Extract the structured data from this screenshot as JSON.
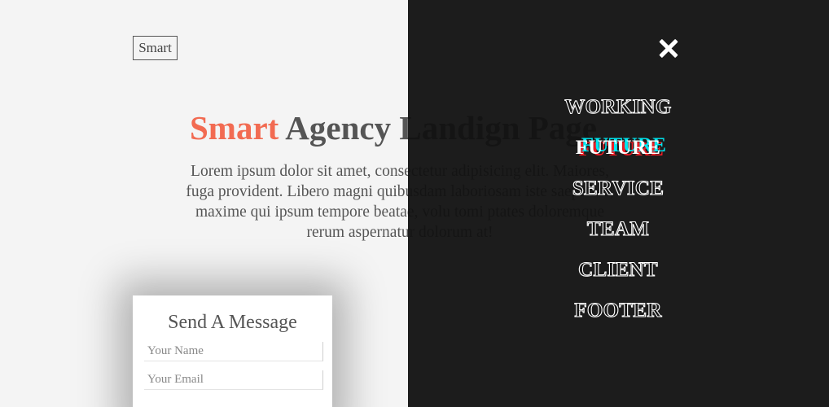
{
  "logo": {
    "text": "Smart"
  },
  "hero": {
    "title_accent": "Smart",
    "title_rest": " Agency Landign Page",
    "text": "Lorem ipsum dolor sit amet, consectetur adipisicing elit. Maiores, fuga provident. Libero magni quibusdam laboriosam iste saepe hic, maxime qui ipsum tempore beatae, volu tomi ptates doloremque rerum aspernatur dolorum at!"
  },
  "message_form": {
    "title": "Send A Message",
    "name_placeholder": "Your Name",
    "email_placeholder": "Your Email"
  },
  "nav_overlay": {
    "close_icon": "close-icon",
    "items": [
      {
        "label": "WORKING"
      },
      {
        "label": "FUTURE"
      },
      {
        "label": "SERVICE"
      },
      {
        "label": "TEAM"
      },
      {
        "label": "CLIENT"
      },
      {
        "label": "FOOTER"
      }
    ]
  },
  "colors": {
    "accent": "#f26b52",
    "overlay": "#121212",
    "glitch_cyan": "#00e6f0",
    "glitch_red": "#ee1d25"
  }
}
